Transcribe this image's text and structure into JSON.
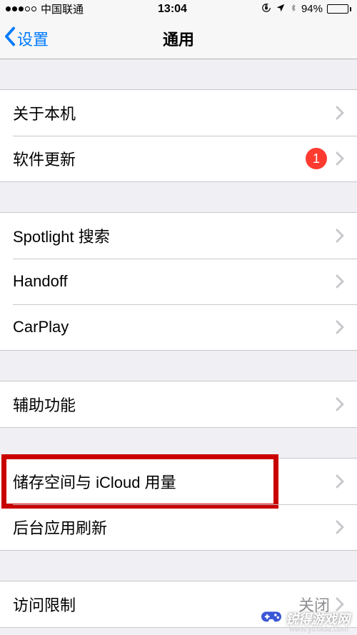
{
  "status": {
    "carrier": "中国联通",
    "time": "13:04",
    "battery_pct": "94%"
  },
  "nav": {
    "back_label": "设置",
    "title": "通用"
  },
  "groups": [
    {
      "rows": [
        {
          "key": "about",
          "label": "关于本机"
        },
        {
          "key": "software-update",
          "label": "软件更新",
          "badge": "1"
        }
      ]
    },
    {
      "rows": [
        {
          "key": "spotlight",
          "label": "Spotlight 搜索"
        },
        {
          "key": "handoff",
          "label": "Handoff"
        },
        {
          "key": "carplay",
          "label": "CarPlay"
        }
      ]
    },
    {
      "rows": [
        {
          "key": "accessibility",
          "label": "辅助功能"
        }
      ]
    },
    {
      "rows": [
        {
          "key": "storage-icloud",
          "label": "储存空间与 iCloud 用量",
          "highlighted": true
        },
        {
          "key": "background-refresh",
          "label": "后台应用刷新"
        }
      ]
    },
    {
      "rows": [
        {
          "key": "restrictions",
          "label": "访问限制",
          "value": "关闭"
        }
      ]
    }
  ],
  "watermark": {
    "brand": "锐得游戏网",
    "url": "www.ytruida.com"
  }
}
